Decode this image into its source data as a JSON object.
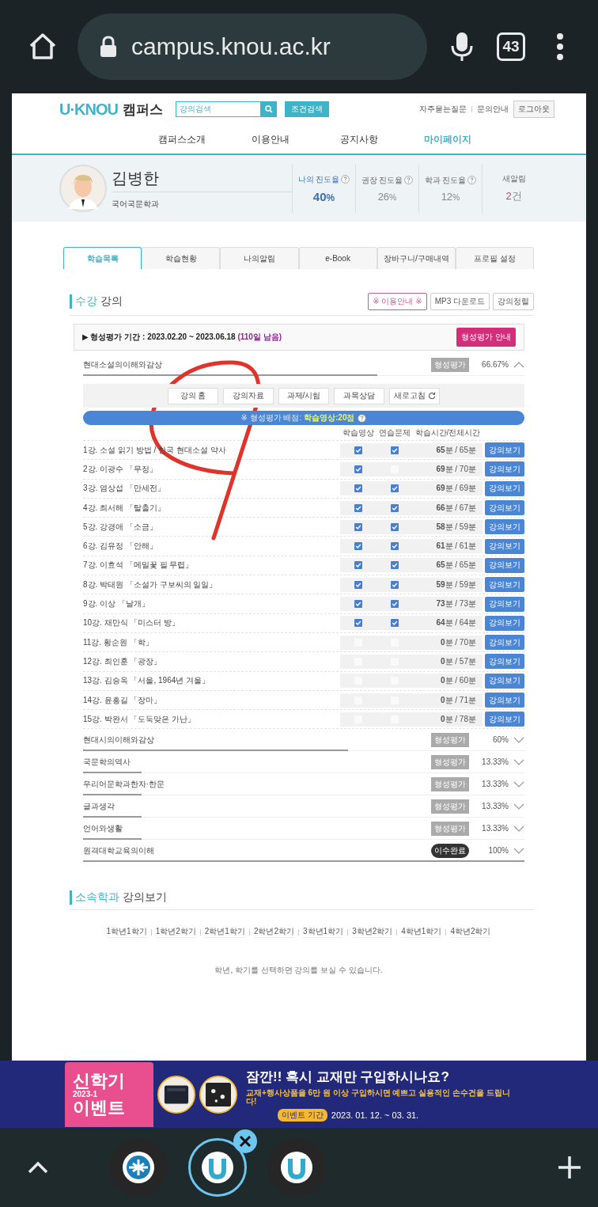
{
  "browser": {
    "url": "campus.knou.ac.kr",
    "tab_count": "43"
  },
  "header": {
    "logo": "U·KNOU",
    "logo_suffix": "캠퍼스",
    "search_placeholder": "강의검색",
    "filter_button": "조건검색",
    "links": [
      "자주묻는질문",
      "문의안내"
    ],
    "logout": "로그아웃"
  },
  "nav": [
    {
      "label": "캠퍼스소개",
      "selected": false
    },
    {
      "label": "이용안내",
      "selected": false
    },
    {
      "label": "공지사항",
      "selected": false
    },
    {
      "label": "마이페이지",
      "selected": true
    }
  ],
  "profile": {
    "name": "김병한",
    "department": "국어국문학과",
    "stats": [
      {
        "label": "나의 진도율",
        "value": "40",
        "unit": "%",
        "help": true,
        "highlighted": true
      },
      {
        "label": "권장 진도율",
        "value": "26",
        "unit": "%",
        "help": true,
        "highlighted": false
      },
      {
        "label": "학과 진도율",
        "value": "12",
        "unit": "%",
        "help": true,
        "highlighted": false
      },
      {
        "label": "새알림",
        "value": "2",
        "unit": "건",
        "help": false,
        "highlighted": false
      }
    ]
  },
  "tabs": [
    {
      "label": "학습목록",
      "selected": true
    },
    {
      "label": "학습현황",
      "selected": false
    },
    {
      "label": "나의알림",
      "selected": false
    },
    {
      "label": "e-Book",
      "selected": false
    },
    {
      "label": "장바구니/구매내역",
      "selected": false
    },
    {
      "label": "프로필 설정",
      "selected": false
    }
  ],
  "section": {
    "accent": "수강",
    "title": "강의",
    "buttons": [
      {
        "label": "※ 이용안내 ※",
        "highlighted": true
      },
      {
        "label": "MP3 다운로드",
        "highlighted": false
      },
      {
        "label": "강의정렬",
        "highlighted": false
      }
    ]
  },
  "notice": {
    "text": "▶ 형성평가 기간 : 2023.02.20 ~ 2023.06.18",
    "remaining": "(110일 남음)",
    "button": "형성평가 안내"
  },
  "courses": [
    {
      "title": "현대소설의이해와감상",
      "badge": {
        "kind": "eval",
        "label": "형성평가"
      },
      "percent": "66.67%",
      "level": 0.6667,
      "expanded": true,
      "toolbar": [
        {
          "label": "강의 홈",
          "icon": false
        },
        {
          "label": "강의자료",
          "icon": false
        },
        {
          "label": "과제/시험",
          "icon": false
        },
        {
          "label": "과목상담",
          "icon": false
        },
        {
          "label": "새로고침",
          "icon": true
        }
      ],
      "info": {
        "text": "※ 형성평가 배점:",
        "highlight": "학습영상:20점"
      },
      "columns": [
        "학습영상",
        "연습문제",
        "학습시간/전체시간"
      ],
      "lectures": [
        {
          "title": "1강. 소설 읽기 방법 / 한국 현대소설 약사",
          "video": true,
          "practice": true,
          "time": "**65**분 / 65분",
          "button": "강의보기"
        },
        {
          "title": "2강. 이광수 「무정」",
          "video": true,
          "practice": false,
          "time": "**69**분 / 70분",
          "button": "강의보기"
        },
        {
          "title": "3강. 염상섭 「만세전」",
          "video": true,
          "practice": true,
          "time": "**69**분 / 69분",
          "button": "강의보기"
        },
        {
          "title": "4강. 최서해 「탈출기」",
          "video": true,
          "practice": true,
          "time": "**66**분 / 67분",
          "button": "강의보기"
        },
        {
          "title": "5강. 강경애 「소금」",
          "video": true,
          "practice": true,
          "time": "**58**분 / 59분",
          "button": "강의보기"
        },
        {
          "title": "6강. 김유정 「안해」",
          "video": true,
          "practice": true,
          "time": "**61**분 / 61분",
          "button": "강의보기"
        },
        {
          "title": "7강. 이효석 「메밀꽃 필 무렵」",
          "video": true,
          "practice": true,
          "time": "**65**분 / 65분",
          "button": "강의보기"
        },
        {
          "title": "8강. 박태원 「소설가 구보씨의 일일」",
          "video": true,
          "practice": true,
          "time": "**59**분 / 59분",
          "button": "강의보기"
        },
        {
          "title": "9강. 이상 「날개」",
          "video": true,
          "practice": true,
          "time": "**73**분 / 73분",
          "button": "강의보기"
        },
        {
          "title": "10강. 채만식 「미스터 방」",
          "video": true,
          "practice": true,
          "time": "**64**분 / 64분",
          "button": "강의보기"
        },
        {
          "title": "11강. 황순원 「학」",
          "video": false,
          "practice": false,
          "time": "**0**분 / 70분",
          "button": "강의보기"
        },
        {
          "title": "12강. 최인훈 「광장」",
          "video": false,
          "practice": false,
          "time": "**0**분 / 57분",
          "button": "강의보기"
        },
        {
          "title": "13강. 김승옥 「서울, 1964년 겨울」",
          "video": false,
          "practice": false,
          "time": "**0**분 / 60분",
          "button": "강의보기"
        },
        {
          "title": "14강. 윤흥길 「장마」",
          "video": false,
          "practice": false,
          "time": "**0**분 / 71분",
          "button": "강의보기"
        },
        {
          "title": "15강. 박완서 「도둑맞은 가난」",
          "video": false,
          "practice": false,
          "time": "**0**분 / 78분",
          "button": "강의보기"
        }
      ]
    },
    {
      "title": "현대시의이해와감상",
      "badge": {
        "kind": "eval",
        "label": "형성평가"
      },
      "percent": "60%",
      "level": 0.6,
      "expanded": false
    },
    {
      "title": "국문학의역사",
      "badge": {
        "kind": "eval",
        "label": "형성평가"
      },
      "percent": "13.33%",
      "level": 0.1333,
      "expanded": false
    },
    {
      "title": "우리어문학과한자·한문",
      "badge": {
        "kind": "eval",
        "label": "형성평가"
      },
      "percent": "13.33%",
      "level": 0.1333,
      "expanded": false
    },
    {
      "title": "글과생각",
      "badge": {
        "kind": "eval",
        "label": "형성평가"
      },
      "percent": "13.33%",
      "level": 0.1333,
      "expanded": false
    },
    {
      "title": "언어와생활",
      "badge": {
        "kind": "eval",
        "label": "형성평가"
      },
      "percent": "13.33%",
      "level": 0.1333,
      "expanded": false
    },
    {
      "title": "원격대학교육의이해",
      "badge": {
        "kind": "done",
        "label": "이수완료"
      },
      "percent": "100%",
      "level": 1,
      "expanded": false
    }
  ],
  "department": {
    "accent": "소속학과",
    "title": "강의보기",
    "semesters": [
      "1학년1학기",
      "1학년2학기",
      "2학년1학기",
      "2학년2학기",
      "3학년1학기",
      "3학년2학기",
      "4학년1학기",
      "4학년2학기"
    ],
    "hint": "학년, 학기를 선택하면 강의를 보실 수 있습니다."
  },
  "banner": {
    "event_title": "신학기",
    "event_year": "2023-1",
    "event_word": "이벤트",
    "headline": "잠깐!! 혹시 교재만 구입하시나요?",
    "subline": "교재+행사상품을 6만 원 이상 구입하시면  예쁘고 실용적인 손수건을 드립니다!",
    "period_label": "이벤트 기간",
    "period": "2023. 01. 12. ~ 03. 31."
  },
  "bottom_tabs": [
    {
      "kind": "knou",
      "selected": false
    },
    {
      "kind": "u",
      "selected": true
    },
    {
      "kind": "u",
      "selected": false
    }
  ]
}
